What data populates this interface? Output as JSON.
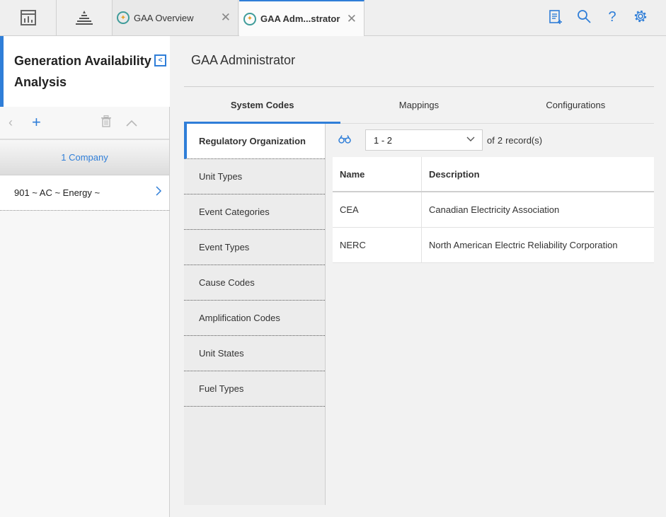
{
  "topbar": {
    "tabs": [
      {
        "label": "GAA Overview"
      },
      {
        "label": "GAA Adm...strator"
      }
    ]
  },
  "left_panel": {
    "title": "Generation Availability Analysis",
    "company_header": "1 Company",
    "companies": [
      {
        "label": "901 ~ AC ~  Energy ~"
      }
    ]
  },
  "main": {
    "title": "GAA Administrator",
    "tabs": [
      {
        "label": "System Codes",
        "active": true
      },
      {
        "label": "Mappings",
        "active": false
      },
      {
        "label": "Configurations",
        "active": false
      }
    ],
    "codes": [
      {
        "label": "Regulatory Organization",
        "active": true
      },
      {
        "label": "Unit Types"
      },
      {
        "label": "Event Categories"
      },
      {
        "label": "Event Types"
      },
      {
        "label": "Cause Codes"
      },
      {
        "label": "Amplification Codes"
      },
      {
        "label": "Unit States"
      },
      {
        "label": "Fuel Types"
      }
    ],
    "pager": {
      "range": "1 - 2",
      "of_label": "of",
      "count": "2",
      "unit": "record(s)"
    },
    "grid": {
      "columns": [
        "Name",
        "Description"
      ],
      "rows": [
        [
          "CEA",
          "Canadian Electricity Association"
        ],
        [
          "NERC",
          "North American Electric Reliability Corporation"
        ]
      ]
    }
  },
  "colors": {
    "accent": "#2f7ed8",
    "tab_icon_ring": "#3f9c9a"
  }
}
